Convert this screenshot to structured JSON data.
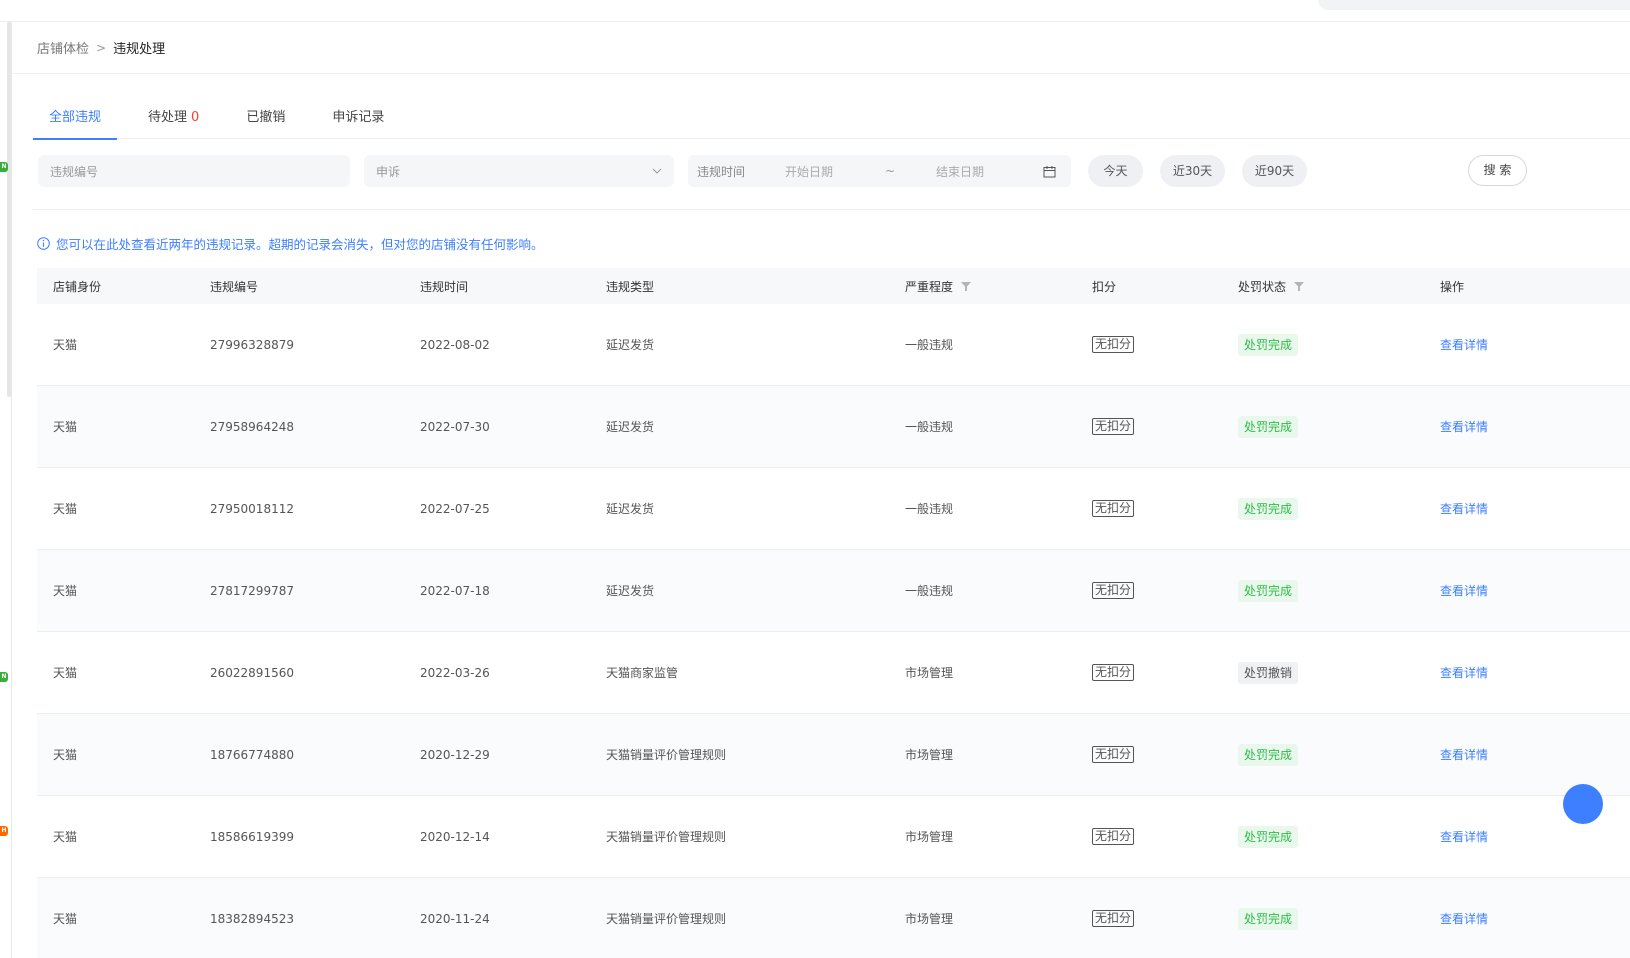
{
  "breadcrumb": {
    "parent": "店铺体检",
    "separator": ">",
    "current": "违规处理"
  },
  "tabs": [
    {
      "label": "全部违规",
      "count": ""
    },
    {
      "label": "待处理",
      "count": "0"
    },
    {
      "label": "已撤销",
      "count": ""
    },
    {
      "label": "申诉记录",
      "count": ""
    }
  ],
  "filters": {
    "violation_no_placeholder": "违规编号",
    "appeal_placeholder": "申诉",
    "date_label": "违规时间",
    "start_placeholder": "开始日期",
    "range_sep": "~",
    "end_placeholder": "结束日期",
    "quick_ranges": [
      "今天",
      "近30天",
      "近90天"
    ],
    "search_label": "搜 索"
  },
  "notice": "您可以在此处查看近两年的违规记录。超期的记录会消失，但对您的店铺没有任何影响。",
  "table": {
    "columns": [
      "店铺身份",
      "违规编号",
      "违规时间",
      "违规类型",
      "严重程度",
      "扣分",
      "处罚状态",
      "操作"
    ],
    "rows": [
      {
        "shop": "天猫",
        "no": "27996328879",
        "time": "2022-08-02",
        "type": "延迟发货",
        "severity": "一般违规",
        "score": "无扣分",
        "status": "处罚完成",
        "status_kind": "done",
        "action": "查看详情"
      },
      {
        "shop": "天猫",
        "no": "27958964248",
        "time": "2022-07-30",
        "type": "延迟发货",
        "severity": "一般违规",
        "score": "无扣分",
        "status": "处罚完成",
        "status_kind": "done",
        "action": "查看详情"
      },
      {
        "shop": "天猫",
        "no": "27950018112",
        "time": "2022-07-25",
        "type": "延迟发货",
        "severity": "一般违规",
        "score": "无扣分",
        "status": "处罚完成",
        "status_kind": "done",
        "action": "查看详情"
      },
      {
        "shop": "天猫",
        "no": "27817299787",
        "time": "2022-07-18",
        "type": "延迟发货",
        "severity": "一般违规",
        "score": "无扣分",
        "status": "处罚完成",
        "status_kind": "done",
        "action": "查看详情"
      },
      {
        "shop": "天猫",
        "no": "26022891560",
        "time": "2022-03-26",
        "type": "天猫商家监管",
        "severity": "市场管理",
        "score": "无扣分",
        "status": "处罚撤销",
        "status_kind": "revoked",
        "action": "查看详情"
      },
      {
        "shop": "天猫",
        "no": "18766774880",
        "time": "2020-12-29",
        "type": "天猫销量评价管理规则",
        "severity": "市场管理",
        "score": "无扣分",
        "status": "处罚完成",
        "status_kind": "done",
        "action": "查看详情"
      },
      {
        "shop": "天猫",
        "no": "18586619399",
        "time": "2020-12-14",
        "type": "天猫销量评价管理规则",
        "severity": "市场管理",
        "score": "无扣分",
        "status": "处罚完成",
        "status_kind": "done",
        "action": "查看详情"
      },
      {
        "shop": "天猫",
        "no": "18382894523",
        "time": "2020-11-24",
        "type": "天猫销量评价管理规则",
        "severity": "市场管理",
        "score": "无扣分",
        "status": "处罚完成",
        "status_kind": "done",
        "action": "查看详情"
      }
    ]
  },
  "icons": {
    "info": "info-circle-icon",
    "calendar": "calendar-icon",
    "chevron": "chevron-down-icon",
    "filter": "filter-icon"
  },
  "colors": {
    "accent": "#3d7fff",
    "success": "#2fbd49",
    "danger": "#ff3b30"
  }
}
